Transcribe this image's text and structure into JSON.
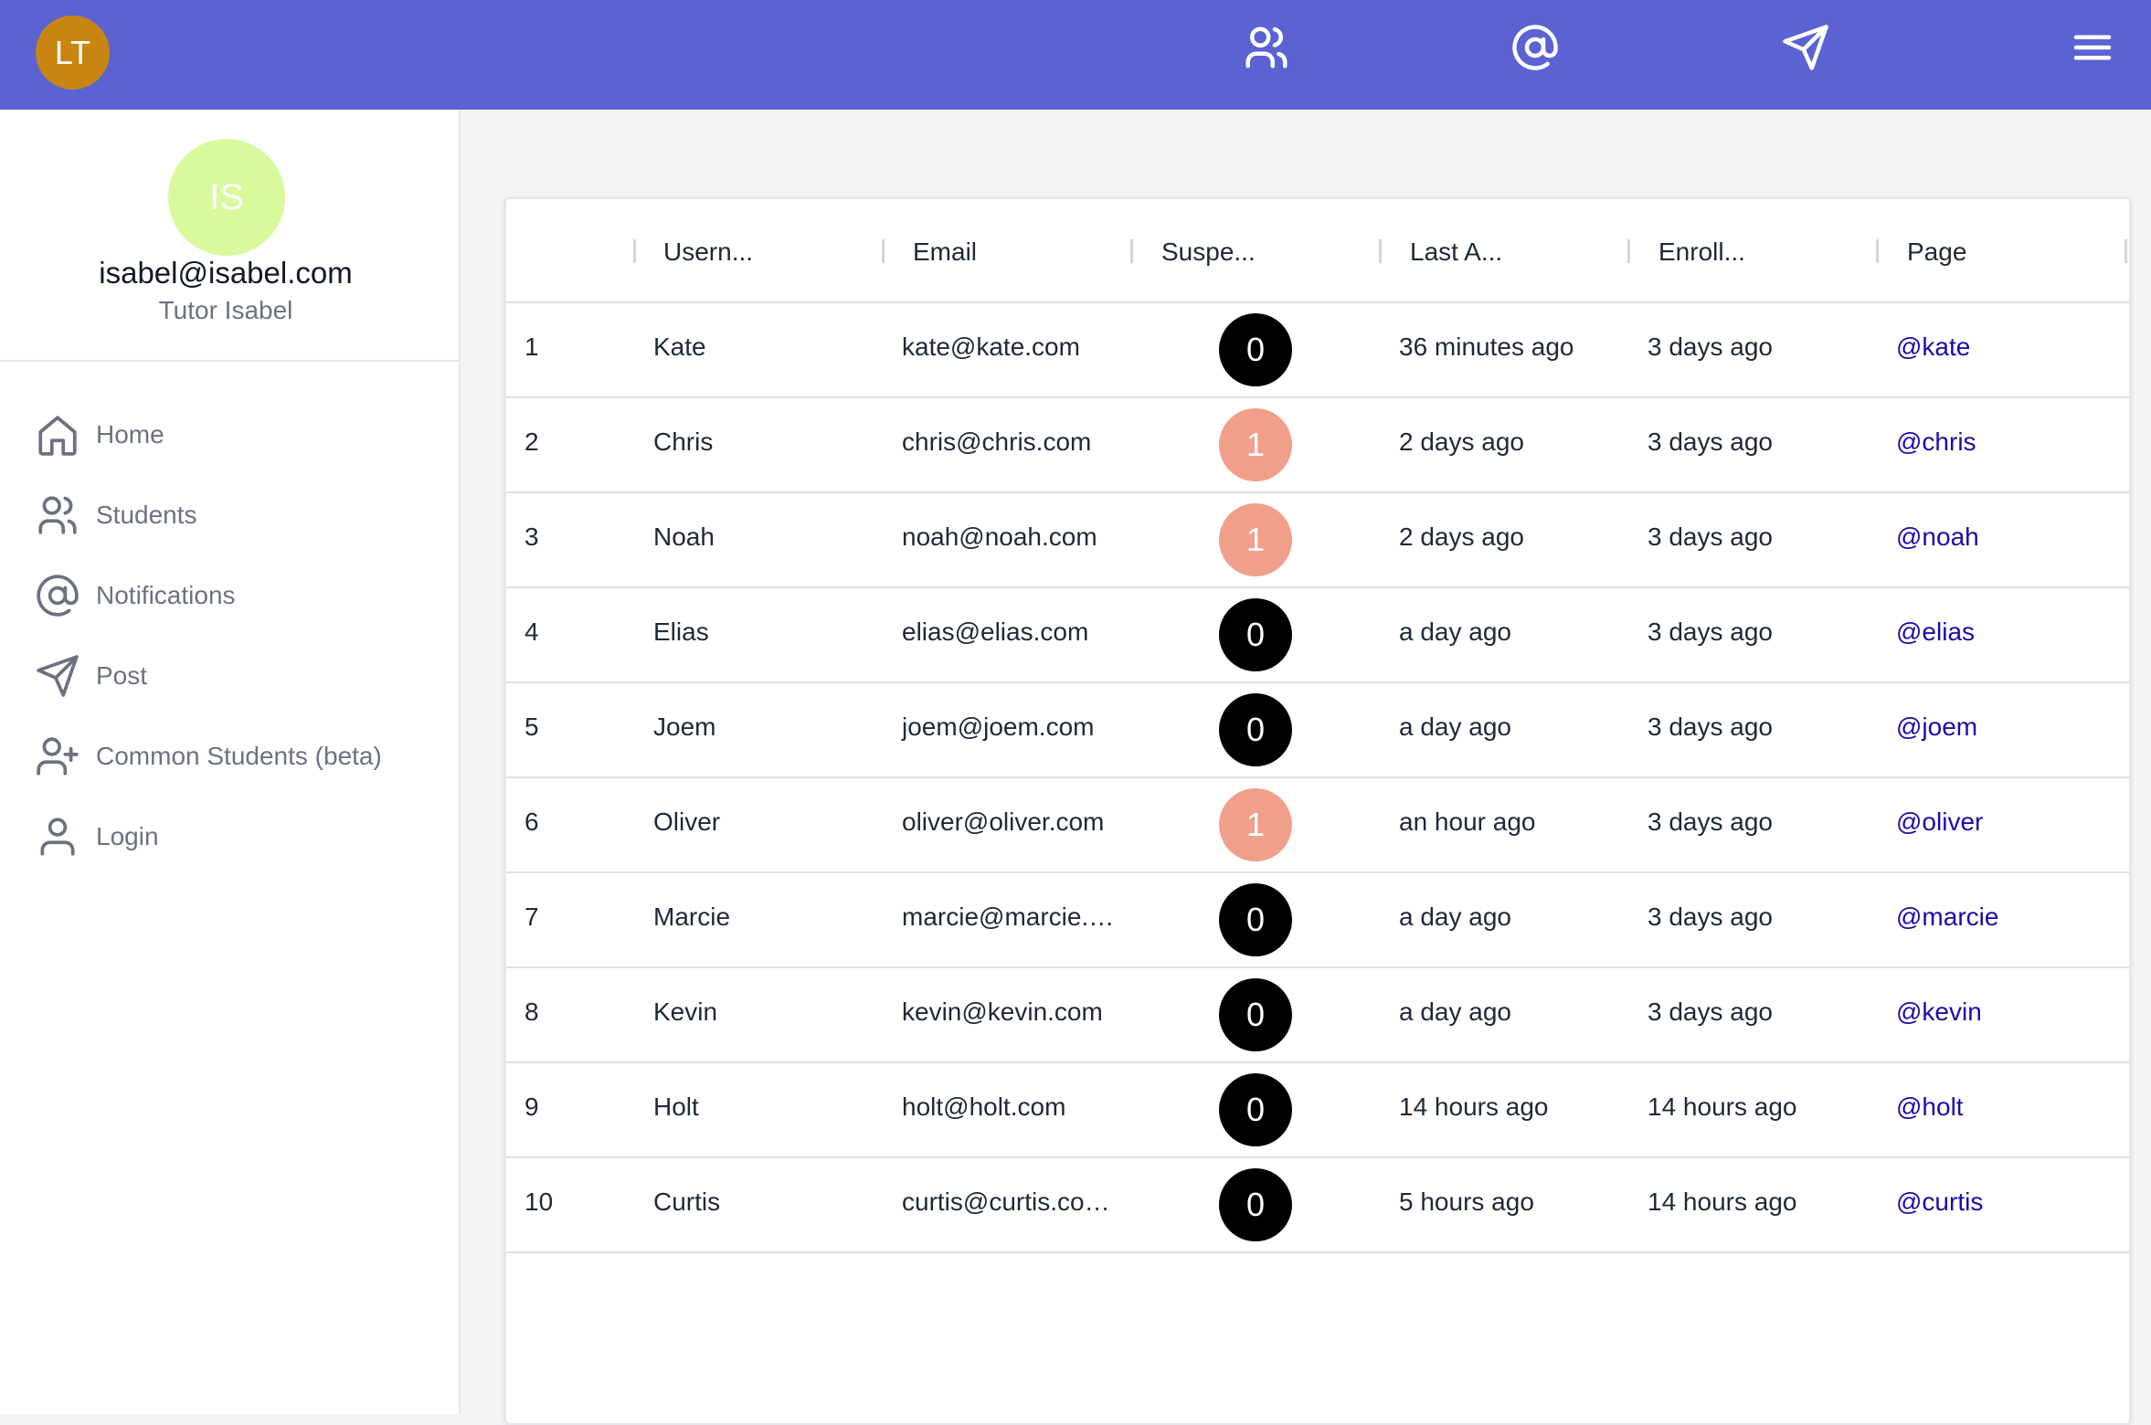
{
  "header": {
    "app_avatar_initials": "LT",
    "app_avatar_color": "#c98511",
    "bar_color": "#5b63d3",
    "icons": [
      "users-icon",
      "at-sign-icon",
      "send-icon",
      "menu-icon"
    ]
  },
  "profile": {
    "initials": "IS",
    "avatar_color": "#d9f99d",
    "email": "isabel@isabel.com",
    "name": "Tutor Isabel"
  },
  "nav": {
    "items": [
      {
        "label": "Home",
        "icon": "home-icon"
      },
      {
        "label": "Students",
        "icon": "users-icon"
      },
      {
        "label": "Notifications",
        "icon": "at-sign-icon"
      },
      {
        "label": "Post",
        "icon": "send-icon"
      },
      {
        "label": "Common Students (beta)",
        "icon": "user-plus-icon"
      },
      {
        "label": "Login",
        "icon": "user-icon"
      }
    ]
  },
  "table": {
    "columns": [
      "Usern...",
      "Email",
      "Suspe...",
      "Last A...",
      "Enroll...",
      "Page"
    ],
    "badge_colors": {
      "0": "#000000",
      "1": "#f0a08a"
    },
    "rows": [
      {
        "index": "1",
        "username": "Kate",
        "email": "kate@kate.com",
        "suspended": "0",
        "last_active": "36 minutes ago",
        "enrolled": "3 days ago",
        "page": "@kate"
      },
      {
        "index": "2",
        "username": "Chris",
        "email": "chris@chris.com",
        "suspended": "1",
        "last_active": "2 days ago",
        "enrolled": "3 days ago",
        "page": "@chris"
      },
      {
        "index": "3",
        "username": "Noah",
        "email": "noah@noah.com",
        "suspended": "1",
        "last_active": "2 days ago",
        "enrolled": "3 days ago",
        "page": "@noah"
      },
      {
        "index": "4",
        "username": "Elias",
        "email": "elias@elias.com",
        "suspended": "0",
        "last_active": "a day ago",
        "enrolled": "3 days ago",
        "page": "@elias"
      },
      {
        "index": "5",
        "username": "Joem",
        "email": "joem@joem.com",
        "suspended": "0",
        "last_active": "a day ago",
        "enrolled": "3 days ago",
        "page": "@joem"
      },
      {
        "index": "6",
        "username": "Oliver",
        "email": "oliver@oliver.com",
        "suspended": "1",
        "last_active": "an hour ago",
        "enrolled": "3 days ago",
        "page": "@oliver"
      },
      {
        "index": "7",
        "username": "Marcie",
        "email": "marcie@marcie.…",
        "suspended": "0",
        "last_active": "a day ago",
        "enrolled": "3 days ago",
        "page": "@marcie"
      },
      {
        "index": "8",
        "username": "Kevin",
        "email": "kevin@kevin.com",
        "suspended": "0",
        "last_active": "a day ago",
        "enrolled": "3 days ago",
        "page": "@kevin"
      },
      {
        "index": "9",
        "username": "Holt",
        "email": "holt@holt.com",
        "suspended": "0",
        "last_active": "14 hours ago",
        "enrolled": "14 hours ago",
        "page": "@holt"
      },
      {
        "index": "10",
        "username": "Curtis",
        "email": "curtis@curtis.co…",
        "suspended": "0",
        "last_active": "5 hours ago",
        "enrolled": "14 hours ago",
        "page": "@curtis"
      }
    ]
  }
}
